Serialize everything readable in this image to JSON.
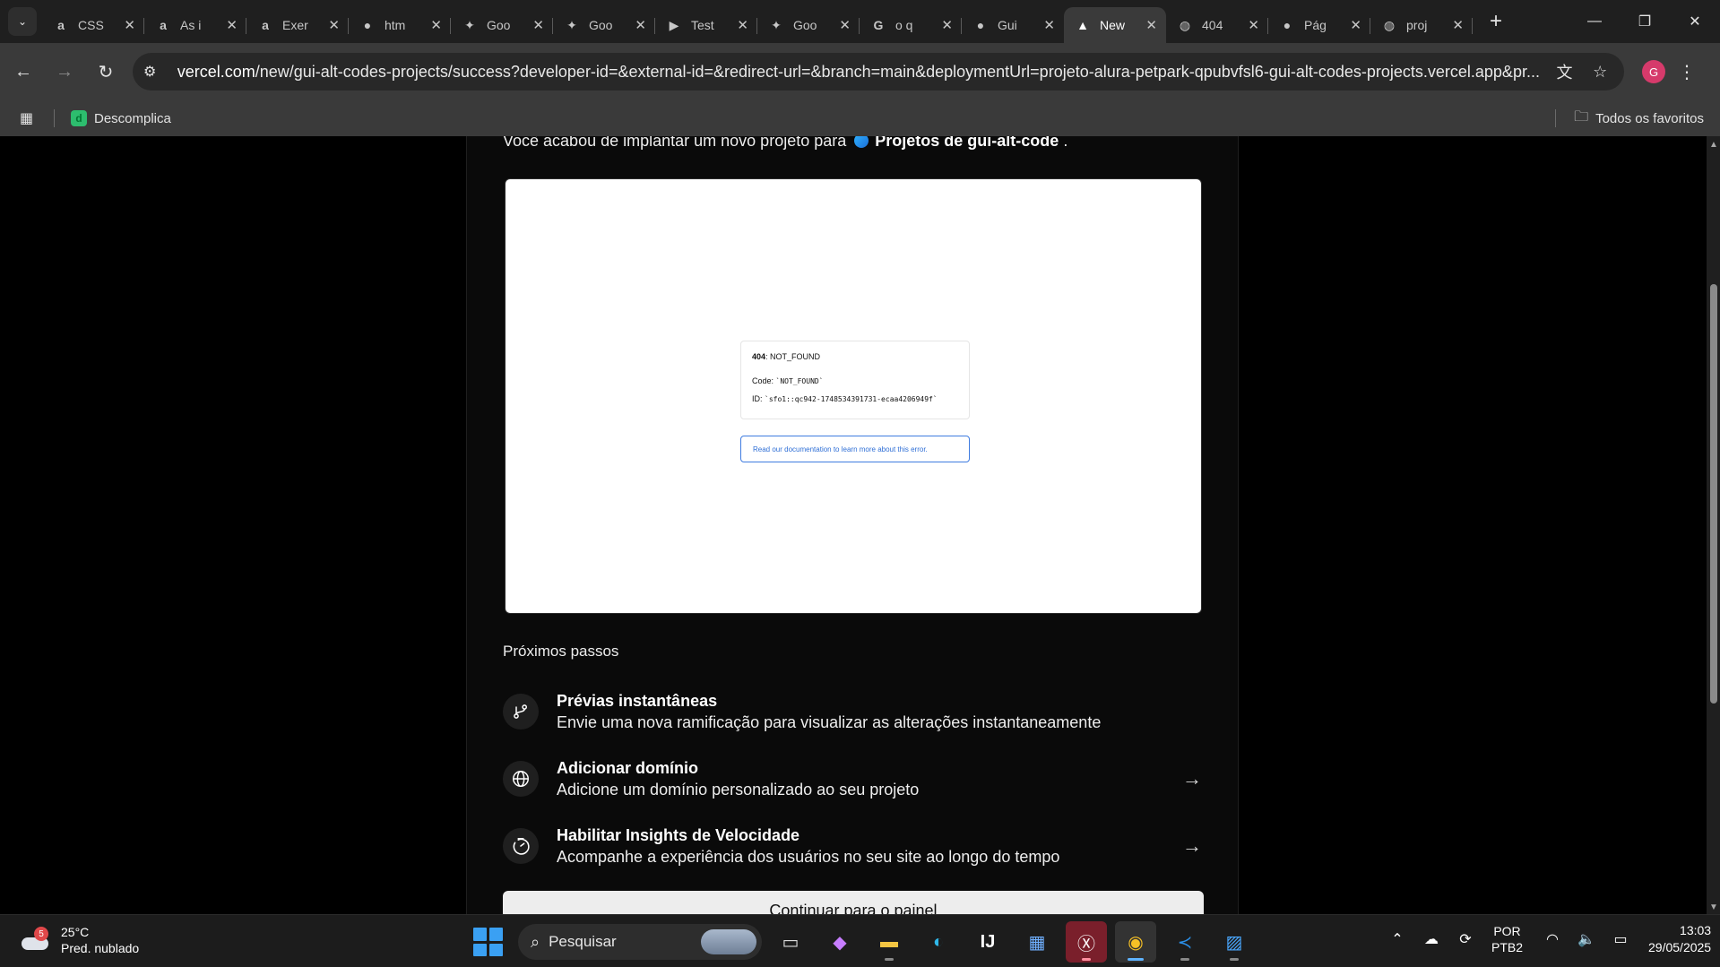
{
  "browser": {
    "tabs": [
      {
        "icon": "alura-icon",
        "glyph": "a",
        "label": "CSS",
        "active": false
      },
      {
        "icon": "alura-icon",
        "glyph": "a",
        "label": "As i",
        "active": false
      },
      {
        "icon": "alura-icon",
        "glyph": "a",
        "label": "Exer",
        "active": false
      },
      {
        "icon": "github-icon",
        "glyph": "●",
        "label": "htm",
        "active": false
      },
      {
        "icon": "gemini-icon",
        "glyph": "✦",
        "label": "Goo",
        "active": false
      },
      {
        "icon": "gemini-icon",
        "glyph": "✦",
        "label": "Goo",
        "active": false
      },
      {
        "icon": "video-icon",
        "glyph": "▶",
        "label": "Test",
        "active": false
      },
      {
        "icon": "gemini-icon",
        "glyph": "✦",
        "label": "Goo",
        "active": false
      },
      {
        "icon": "google-icon",
        "glyph": "G",
        "label": "o q",
        "active": false
      },
      {
        "icon": "github-icon",
        "glyph": "●",
        "label": "Gui",
        "active": false
      },
      {
        "icon": "vercel-icon",
        "glyph": "▲",
        "label": "New",
        "active": true
      },
      {
        "icon": "globe-icon",
        "glyph": "◍",
        "label": "404",
        "active": false
      },
      {
        "icon": "github-icon",
        "glyph": "●",
        "label": "Pág",
        "active": false
      },
      {
        "icon": "globe-icon",
        "glyph": "◍",
        "label": "proj",
        "active": false
      }
    ],
    "url_host": "vercel.com",
    "url_path": "/new/gui-alt-codes-projects/success?developer-id=&external-id=&redirect-url=&branch=main&deploymentUrl=projeto-alura-petpark-qpubvfsl6-gui-alt-codes-projects.vercel.app&pr...",
    "profile_initial": "G",
    "bookmark": "Descomplica",
    "all_bookmarks": "Todos os favoritos"
  },
  "page": {
    "intro_prefix": "Você acabou de implantar um novo projeto para",
    "team_name": "Projetos de gui-alt-code",
    "intro_suffix": ".",
    "preview": {
      "error_code": "404",
      "error_name": ": NOT_FOUND",
      "code_label": "Code: ",
      "code_value": "`NOT_FOUND`",
      "id_label": "ID: ",
      "id_value": "`sfo1::qc942-1748534391731-ecaa4206949f`",
      "doc_link": "Read our documentation to learn more about this error."
    },
    "next_steps_title": "Próximos passos",
    "steps": [
      {
        "icon": "branch-icon",
        "title": "Prévias instantâneas",
        "desc": "Envie uma nova ramificação para visualizar as alterações instantaneamente",
        "has_arrow": false
      },
      {
        "icon": "globe-icon",
        "title": "Adicionar domínio",
        "desc": "Adicione um domínio personalizado ao seu projeto",
        "has_arrow": true
      },
      {
        "icon": "speed-icon",
        "title": "Habilitar Insights de Velocidade",
        "desc": "Acompanhe a experiência dos usuários no seu site ao longo do tempo",
        "has_arrow": true
      }
    ],
    "continue_button": "Continuar para o painel"
  },
  "taskbar": {
    "weather_badge": "5",
    "temperature": "25°C",
    "weather_desc": "Pred. nublado",
    "search_placeholder": "Pesquisar",
    "lang_top": "POR",
    "lang_bottom": "PTB2",
    "time": "13:03",
    "date": "29/05/2025"
  }
}
